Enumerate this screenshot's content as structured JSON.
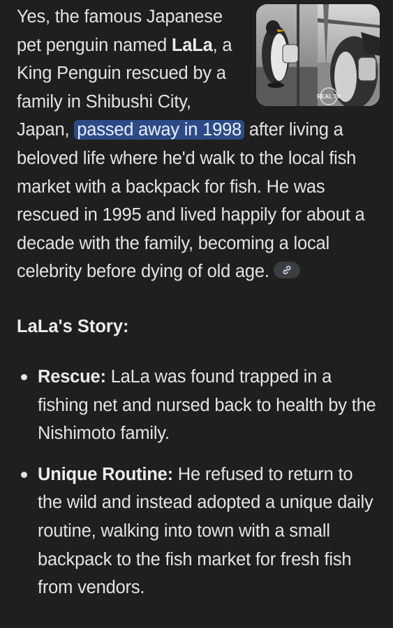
{
  "answer": {
    "intro_1": "Yes, the famous Japanese pet penguin named ",
    "name": "LaLa",
    "intro_2": ", a King Penguin rescued by a family in Shibushi City, Japan, ",
    "highlight": "passed away in 1998",
    "intro_3": " after living a beloved life where he'd walk to the local fish market with a backpack for fish. He was rescued in 1995 and lived happily for about a decade with the family, becoming a local celebrity before dying of old age.",
    "source_icon": "link-icon"
  },
  "thumbnail": {
    "watermark": "REAL TV"
  },
  "section": {
    "title": "LaLa's Story:"
  },
  "items": [
    {
      "label": "Rescue:",
      "text": " LaLa was found trapped in a fishing net and nursed back to health by the Nishimoto family."
    },
    {
      "label": "Unique Routine:",
      "text": " He refused to return to the wild and instead adopted a unique daily routine, walking into town with a small backpack to the fish market for fresh fish from vendors."
    }
  ],
  "colors": {
    "background": "#1f1f1f",
    "text": "#e3e3e3",
    "highlight": "#2c4a86"
  }
}
